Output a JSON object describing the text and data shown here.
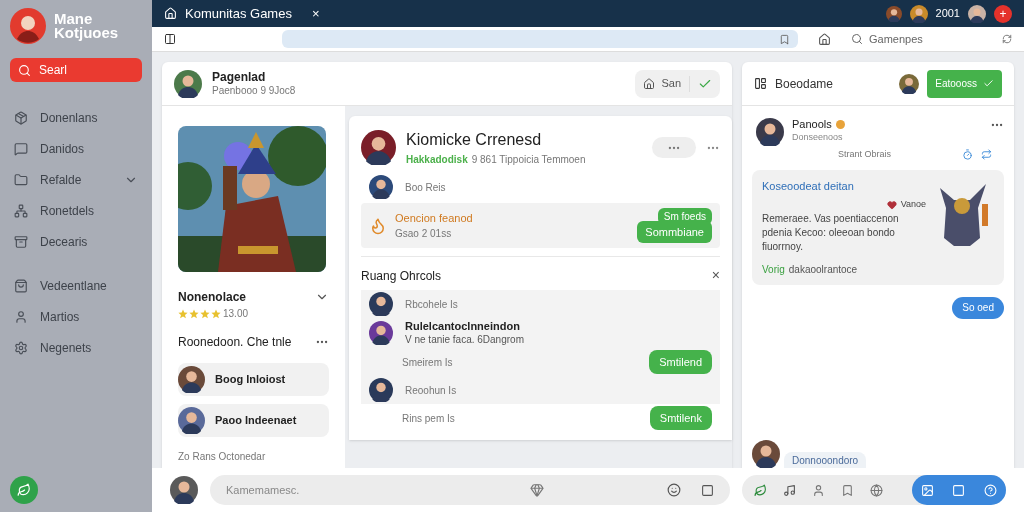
{
  "app": {
    "logo_lines": [
      "Mane",
      "Kotjuoes"
    ]
  },
  "sidebar": {
    "search_button": "Searl",
    "items": [
      {
        "label": "Donenlans",
        "kind": "link"
      },
      {
        "label": "Danidos",
        "kind": "link"
      },
      {
        "label": "Refalde",
        "kind": "group"
      },
      {
        "label": "Ronetdels",
        "kind": "link"
      },
      {
        "label": "Decearis",
        "kind": "link"
      },
      {
        "label": "Vedeentlane",
        "kind": "link"
      },
      {
        "label": "Martios",
        "kind": "link"
      },
      {
        "label": "Negenets",
        "kind": "link"
      }
    ]
  },
  "tab": {
    "title": "Komunitas Games",
    "close": "×"
  },
  "top_bar": {
    "count": "2001",
    "add": "+"
  },
  "toolbar": {
    "search_placeholder": "Gamenpes"
  },
  "profile_header": {
    "name": "Pagenlad",
    "subtitle": "Paenbooo 9 9Joc8",
    "button": "San"
  },
  "game_card": {
    "title": "Nonenolace",
    "stars": 4,
    "rating": "13.00",
    "subtitle": "Roonedoon. Che tnle",
    "friends": [
      "Boog Inloiost",
      "Paoo Indeenaet"
    ],
    "footer": "Zo Rans Octonedar"
  },
  "post": {
    "title": "Kiomicke Crrenesd",
    "tag": "Hakkadodisk",
    "meta": "9 861 Tippoicia Temmoen",
    "commenter": "Boo Reis",
    "event_title": "Oencion feanod",
    "event_date": "Gsao 2 01ss",
    "event_buttons": [
      "Sm foeds",
      "Sommbiane"
    ]
  },
  "room": {
    "title": "Ruang Ohrcols",
    "close": "×",
    "items": [
      {
        "kind": "line",
        "text": "Rbcohele Is"
      },
      {
        "kind": "feature",
        "title": "Rulelcantoclnneindon",
        "text": "V ne tanie faca. 6Dangrom"
      },
      {
        "kind": "action",
        "text": "Smeirem Is",
        "button": "Smtilend"
      },
      {
        "kind": "line",
        "text": "Reoohun Is"
      },
      {
        "kind": "action",
        "text": "Rins pem Is",
        "button": "Smtilenk"
      }
    ]
  },
  "chat": {
    "title": "Boeodame",
    "button": "Eatoooss",
    "author": "Panools",
    "author_sub": "Donseenoos",
    "status": "Strant Obrais",
    "card_title": "Koseoodeat deitan",
    "card_tag": "Vanoe",
    "card_text": "Remeraee. Vas poentiaccenon pdenia Kecoo: oleeoan bondo fiuorrnoy.",
    "card_footer_tag": "Vorig",
    "card_footer": "dakaoolrantoce",
    "reply": "So oed",
    "last_message": "Donnooondoro"
  },
  "composer": {
    "placeholder": "Kamemamesc."
  }
}
